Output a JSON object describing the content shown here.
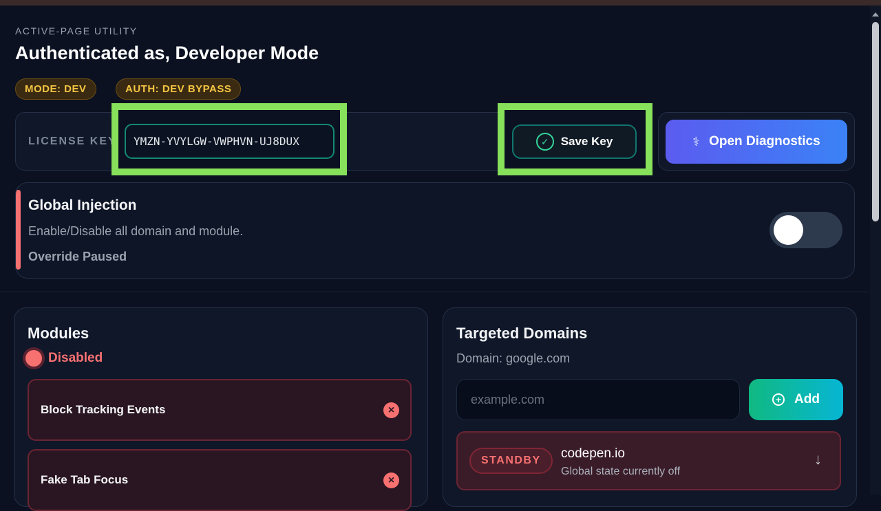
{
  "header": {
    "eyebrow": "ACTIVE-PAGE UTILITY",
    "title": "Authenticated as, Developer Mode",
    "badges": {
      "mode": "MODE: DEV",
      "auth": "AUTH: DEV BYPASS"
    }
  },
  "license": {
    "label": "LICENSE KEY",
    "value": "YMZN-YVYLGW-VWPHVN-UJ8DUX",
    "save_label": "Save Key",
    "diagnostics_label": "Open Diagnostics"
  },
  "injection": {
    "title": "Global Injection",
    "description": "Enable/Disable all domain and module.",
    "status": "Override Paused",
    "toggle_on": false
  },
  "modules": {
    "title": "Modules",
    "status": "Disabled",
    "items": [
      {
        "label": "Block Tracking Events"
      },
      {
        "label": "Fake Tab Focus"
      }
    ]
  },
  "domains": {
    "title": "Targeted Domains",
    "current": "Domain: google.com",
    "input_placeholder": "example.com",
    "add_label": "Add",
    "items": [
      {
        "badge": "STANDBY",
        "name": "codepen.io",
        "subtitle": "Global state currently off"
      }
    ]
  },
  "colors": {
    "background": "#0b1120",
    "badge_text": "#f5c542",
    "highlight": "#88e15b",
    "danger": "#f87171",
    "diagnostics_gradient": [
      "#5b5cf0",
      "#3b82f6"
    ],
    "add_gradient": [
      "#10b981",
      "#06b6d4"
    ]
  }
}
